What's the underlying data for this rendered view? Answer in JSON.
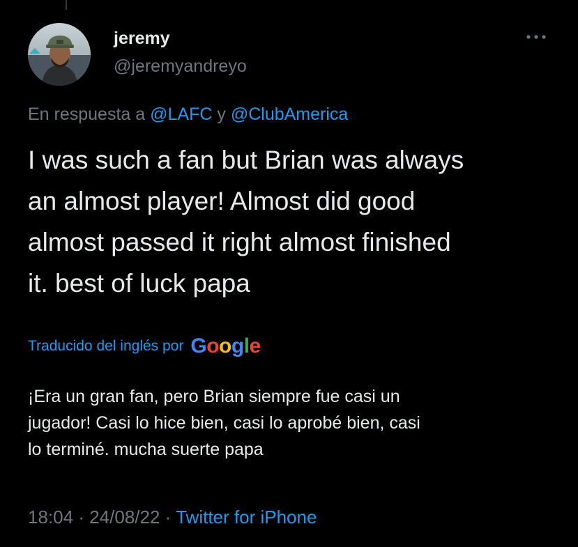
{
  "tweet": {
    "author": {
      "display_name": "jeremy",
      "handle": "@jeremyandreyo"
    },
    "more_icon": "more-horizontal-icon",
    "reply_prefix": "En respuesta a",
    "reply_mentions": [
      "@LAFC",
      "@ClubAmerica"
    ],
    "reply_conjunction": "y",
    "text_lines": [
      "I was such a fan but Brian was always",
      "an almost player! Almost did good",
      "almost passed it right almost finished",
      "it. best of luck papa"
    ],
    "translation": {
      "label": "Traducido del inglés por",
      "provider_letters": [
        "G",
        "o",
        "o",
        "g",
        "l",
        "e"
      ],
      "provider_colors": [
        "#4285f4",
        "#ea4335",
        "#fbbc05",
        "#4285f4",
        "#34a853",
        "#ea4335"
      ],
      "text_lines": [
        "¡Era un gran fan, pero Brian siempre fue casi un",
        "jugador! Casi lo hice bien, casi lo aprobé bien, casi",
        "lo terminé. mucha suerte papa"
      ]
    },
    "time": "18:04",
    "date": "24/08/22",
    "separator": "·",
    "source": "Twitter for iPhone"
  },
  "colors": {
    "background": "#000000",
    "text": "#e7e9ea",
    "muted": "#71767b",
    "accent": "#1d9bf0"
  }
}
